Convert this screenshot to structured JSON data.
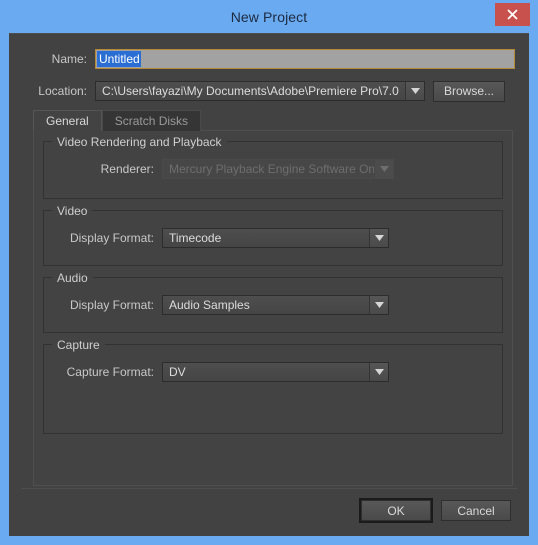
{
  "window": {
    "title": "New Project",
    "close_icon": "close-icon",
    "accent_blue": "#6aaaf0",
    "dialog_bg": "#424242",
    "close_bg": "#c8514d"
  },
  "fields": {
    "name_label": "Name:",
    "name_value": "Untitled",
    "location_label": "Location:",
    "location_value": "C:\\Users\\fayazi\\My Documents\\Adobe\\Premiere Pro\\7.0",
    "browse_label": "Browse..."
  },
  "tabs": [
    {
      "label": "General",
      "active": true
    },
    {
      "label": "Scratch Disks",
      "active": false
    }
  ],
  "groups": {
    "rendering": {
      "title": "Video Rendering and Playback",
      "renderer_label": "Renderer:",
      "renderer_value": "Mercury Playback Engine Software Only",
      "renderer_disabled": true
    },
    "video": {
      "title": "Video",
      "display_format_label": "Display Format:",
      "display_format_value": "Timecode"
    },
    "audio": {
      "title": "Audio",
      "display_format_label": "Display Format:",
      "display_format_value": "Audio Samples"
    },
    "capture": {
      "title": "Capture",
      "capture_format_label": "Capture Format:",
      "capture_format_value": "DV"
    }
  },
  "footer": {
    "ok_label": "OK",
    "cancel_label": "Cancel"
  }
}
